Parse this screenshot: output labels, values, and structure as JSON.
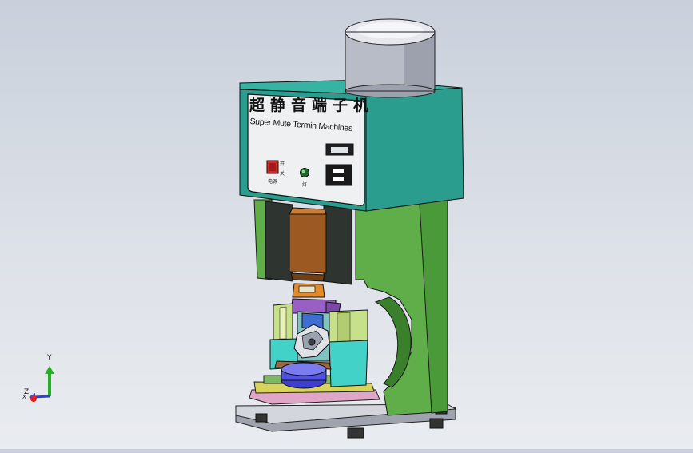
{
  "machine": {
    "title_cn": "超静音端子机",
    "subtitle_en": "Super Mute Termin Machines",
    "power_label": "电源",
    "power_switch_marks": [
      "开",
      "关"
    ],
    "indicator_label": "灯"
  },
  "triad": {
    "x_label": "X",
    "y_label": "Y",
    "z_label": "Z"
  },
  "colors": {
    "background_top": "#c9d0db",
    "body_green": "#5fae4a",
    "panel_teal": "#2a9d8f",
    "motor_gray": "#b8bcc6",
    "die_orange": "#c87a2a"
  }
}
